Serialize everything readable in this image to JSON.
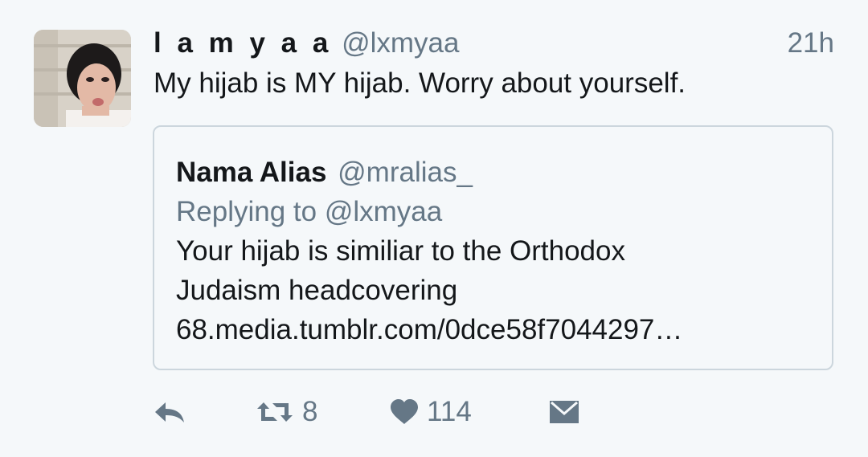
{
  "tweet": {
    "author": {
      "display_name": "l a m y a a",
      "handle": "@lxmyaa",
      "avatar_icon": "profile-photo"
    },
    "timestamp": "21h",
    "text": "My hijab is MY hijab. Worry about yourself."
  },
  "quoted_tweet": {
    "display_name": "Nama Alias",
    "handle": "@mralias_",
    "replying_to": "Replying to @lxmyaa",
    "text_lines": [
      "Your hijab is similiar to the Orthodox",
      "Judaism headcovering",
      "68.media.tumblr.com/0dce58f7044297…"
    ]
  },
  "actions": {
    "reply": {
      "icon": "reply-icon"
    },
    "retweet": {
      "icon": "retweet-icon",
      "count": "8"
    },
    "like": {
      "icon": "heart-icon",
      "count": "114"
    },
    "direct_message": {
      "icon": "envelope-icon"
    }
  },
  "colors": {
    "background": "#f5f8fa",
    "primary_text": "#14171a",
    "secondary_text": "#657786",
    "border": "#ccd6dd"
  }
}
